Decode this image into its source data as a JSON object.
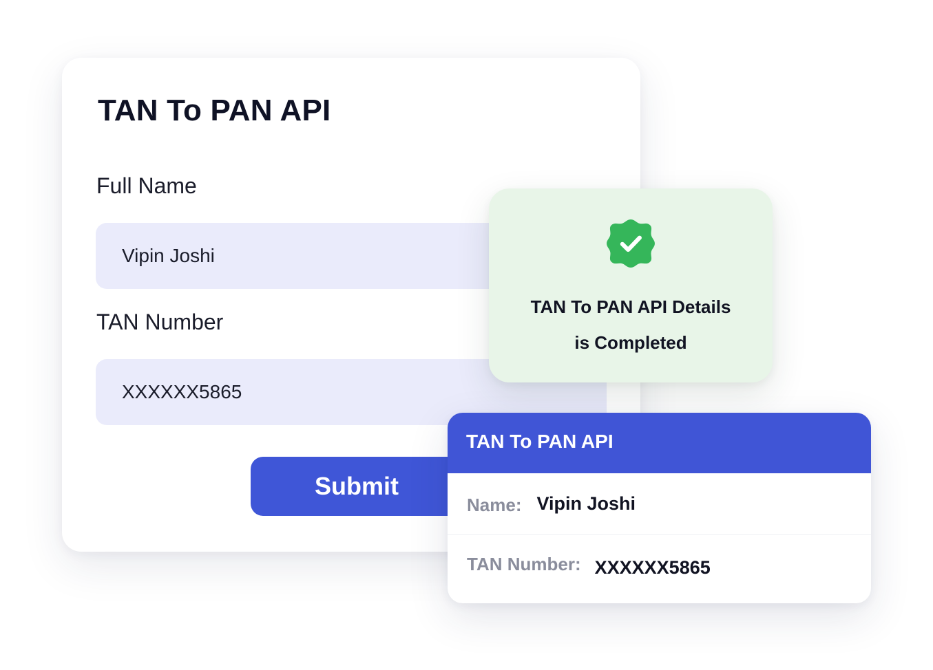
{
  "form": {
    "title": "TAN To PAN API",
    "full_name_label": "Full Name",
    "full_name_value": "Vipin Joshi",
    "tan_label": "TAN Number",
    "tan_value": "XXXXXX5865",
    "submit_label": "Submit"
  },
  "success": {
    "icon": "check-badge-icon",
    "line1": "TAN To PAN API Details",
    "line2": "is Completed",
    "color": "#35b65a"
  },
  "result": {
    "title": "TAN To PAN API",
    "name_key": "Name:",
    "name_value": "Vipin Joshi",
    "tan_key": "TAN Number:",
    "tan_value": "XXXXXX5865"
  },
  "colors": {
    "accent": "#3f56d7",
    "input_bg": "#eaebfb",
    "success_bg": "#e8f5e8"
  }
}
